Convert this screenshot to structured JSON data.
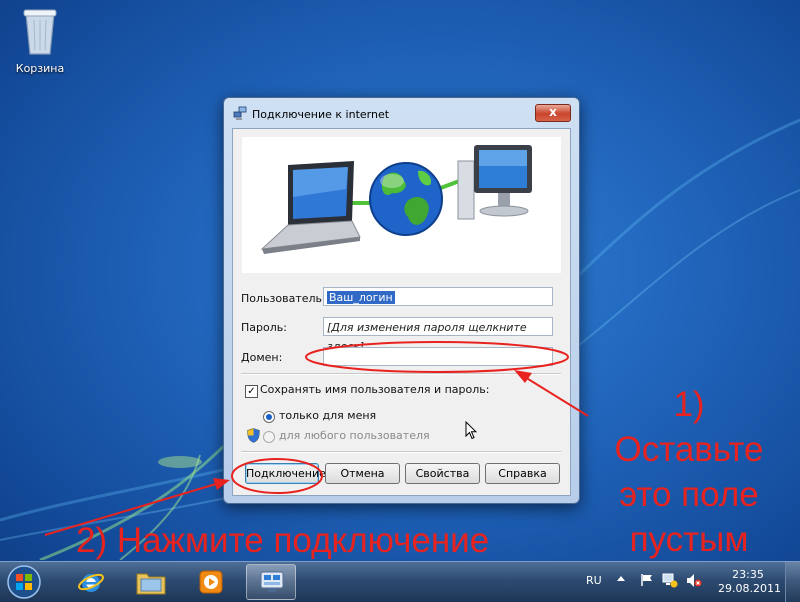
{
  "desktop": {
    "recycle_bin_label": "Корзина"
  },
  "dialog": {
    "title": "Подключение к internet",
    "close_label": "x",
    "fields": {
      "user_label": "Пользователь:",
      "user_value": "Ваш_логин",
      "password_label": "Пароль:",
      "password_hint": "[Для изменения пароля щелкните здесь]",
      "domain_label": "Домен:",
      "domain_value": ""
    },
    "save_checkbox": {
      "label": "Сохранять имя пользователя и пароль:",
      "checked": true
    },
    "options": [
      {
        "label": "только для меня",
        "selected": true,
        "enabled": true
      },
      {
        "label": "для любого пользователя",
        "selected": false,
        "enabled": false
      }
    ],
    "buttons": {
      "connect": "Подключение",
      "cancel": "Отмена",
      "properties": "Свойства",
      "help": "Справка"
    }
  },
  "annotations": {
    "note1_lines": [
      "1)",
      "Оставьте",
      "это поле",
      "пустым"
    ],
    "note2": "2) Нажмите подключение",
    "color": "#e8231f"
  },
  "taskbar": {
    "items": [
      "start-orb-icon",
      "internet-explorer-icon",
      "explorer-folder-icon",
      "media-player-icon",
      "network-connection-icon"
    ],
    "language": "RU",
    "time": "23:35",
    "date": "29.08.2011"
  }
}
